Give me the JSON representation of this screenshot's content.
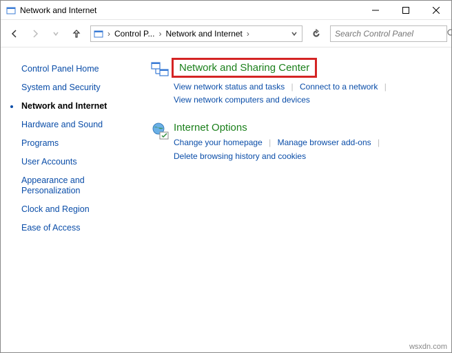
{
  "window": {
    "title": "Network and Internet"
  },
  "breadcrumbs": {
    "level1": "Control P...",
    "level2": "Network and Internet"
  },
  "search": {
    "placeholder": "Search Control Panel"
  },
  "sidebar": {
    "items": [
      {
        "label": "Control Panel Home",
        "current": false
      },
      {
        "label": "System and Security",
        "current": false
      },
      {
        "label": "Network and Internet",
        "current": true
      },
      {
        "label": "Hardware and Sound",
        "current": false
      },
      {
        "label": "Programs",
        "current": false
      },
      {
        "label": "User Accounts",
        "current": false
      },
      {
        "label": "Appearance and Personalization",
        "current": false
      },
      {
        "label": "Clock and Region",
        "current": false
      },
      {
        "label": "Ease of Access",
        "current": false
      }
    ]
  },
  "sections": {
    "network": {
      "heading": "Network and Sharing Center",
      "link1": "View network status and tasks",
      "link2": "Connect to a network",
      "link3": "View network computers and devices"
    },
    "internet": {
      "heading": "Internet Options",
      "link1": "Change your homepage",
      "link2": "Manage browser add-ons",
      "link3": "Delete browsing history and cookies"
    }
  },
  "watermark": "wsxdn.com"
}
